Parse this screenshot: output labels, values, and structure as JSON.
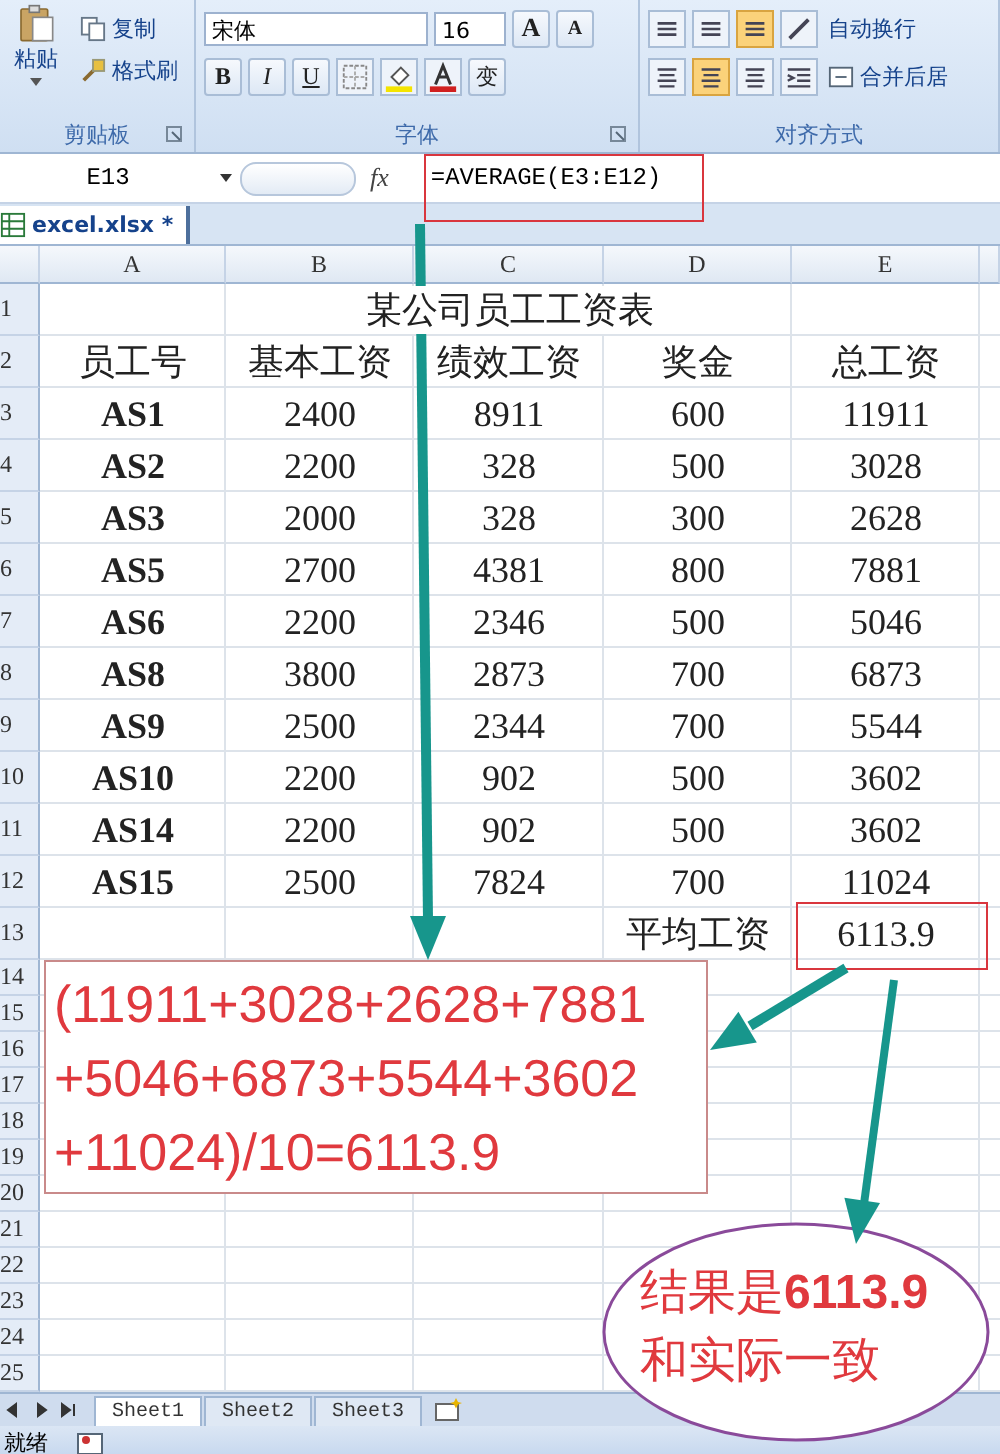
{
  "clipboard": {
    "paste": "粘贴",
    "copy": "复制",
    "format_painter": "格式刷",
    "label": "剪贴板"
  },
  "font": {
    "name": "宋体",
    "size": "16",
    "grow": "A",
    "shrink": "A",
    "bold": "B",
    "italic": "I",
    "underline": "U",
    "phonetic": "变",
    "label": "字体"
  },
  "alignment": {
    "wrap": "自动换行",
    "merge": "合并后居",
    "label": "对齐方式",
    "vertical_buttons": [
      {
        "selected": false
      },
      {
        "selected": false
      },
      {
        "selected": true
      }
    ],
    "horizontal_buttons": [
      {
        "selected": false
      },
      {
        "selected": true
      },
      {
        "selected": false
      }
    ]
  },
  "formula_bar": {
    "cell": "E13",
    "fx": "fx",
    "formula": "=AVERAGE(E3:E12)"
  },
  "workbook_tab": "excel.xlsx *",
  "sheet": {
    "columns": [
      "A",
      "B",
      "C",
      "D",
      "E"
    ],
    "rows": [
      {
        "number": "1",
        "kind": "title",
        "text": "某公司员工工资表"
      },
      {
        "number": "2",
        "kind": "header",
        "cells": [
          "员工号",
          "基本工资",
          "绩效工资",
          "奖金",
          "总工资"
        ]
      },
      {
        "number": "3",
        "kind": "data",
        "cells": [
          "AS1",
          "2400",
          "8911",
          "600",
          "11911"
        ]
      },
      {
        "number": "4",
        "kind": "data",
        "cells": [
          "AS2",
          "2200",
          "328",
          "500",
          "3028"
        ]
      },
      {
        "number": "5",
        "kind": "data",
        "cells": [
          "AS3",
          "2000",
          "328",
          "300",
          "2628"
        ]
      },
      {
        "number": "6",
        "kind": "data",
        "cells": [
          "AS5",
          "2700",
          "4381",
          "800",
          "7881"
        ]
      },
      {
        "number": "7",
        "kind": "data",
        "cells": [
          "AS6",
          "2200",
          "2346",
          "500",
          "5046"
        ]
      },
      {
        "number": "8",
        "kind": "data",
        "cells": [
          "AS8",
          "3800",
          "2873",
          "700",
          "6873"
        ]
      },
      {
        "number": "9",
        "kind": "data",
        "cells": [
          "AS9",
          "2500",
          "2344",
          "700",
          "5544"
        ]
      },
      {
        "number": "10",
        "kind": "data",
        "cells": [
          "AS10",
          "2200",
          "902",
          "500",
          "3602"
        ]
      },
      {
        "number": "11",
        "kind": "data",
        "cells": [
          "AS14",
          "2200",
          "902",
          "500",
          "3602"
        ]
      },
      {
        "number": "12",
        "kind": "data",
        "cells": [
          "AS15",
          "2500",
          "7824",
          "700",
          "11024"
        ]
      },
      {
        "number": "13",
        "kind": "summary",
        "label": "平均工资",
        "value": "6113.9"
      },
      {
        "number": "14",
        "kind": "empty"
      },
      {
        "number": "15",
        "kind": "empty"
      },
      {
        "number": "16",
        "kind": "empty"
      },
      {
        "number": "17",
        "kind": "empty"
      },
      {
        "number": "18",
        "kind": "empty"
      },
      {
        "number": "19",
        "kind": "empty"
      },
      {
        "number": "20",
        "kind": "empty"
      },
      {
        "number": "21",
        "kind": "empty"
      },
      {
        "number": "22",
        "kind": "empty"
      },
      {
        "number": "23",
        "kind": "empty"
      },
      {
        "number": "24",
        "kind": "empty"
      },
      {
        "number": "25",
        "kind": "empty"
      }
    ]
  },
  "annotations": {
    "formula_note": [
      "(11911+3028+2628+7881",
      "+5046+6873+5544+3602",
      "+11024)/10=6113.9"
    ],
    "result_note": [
      "结果是**6113.9**",
      "和实际一致"
    ]
  },
  "sheet_tabs": [
    {
      "label": "Sheet1",
      "selected": true
    },
    {
      "label": "Sheet2",
      "selected": false
    },
    {
      "label": "Sheet3",
      "selected": false
    }
  ],
  "status": "就绪"
}
